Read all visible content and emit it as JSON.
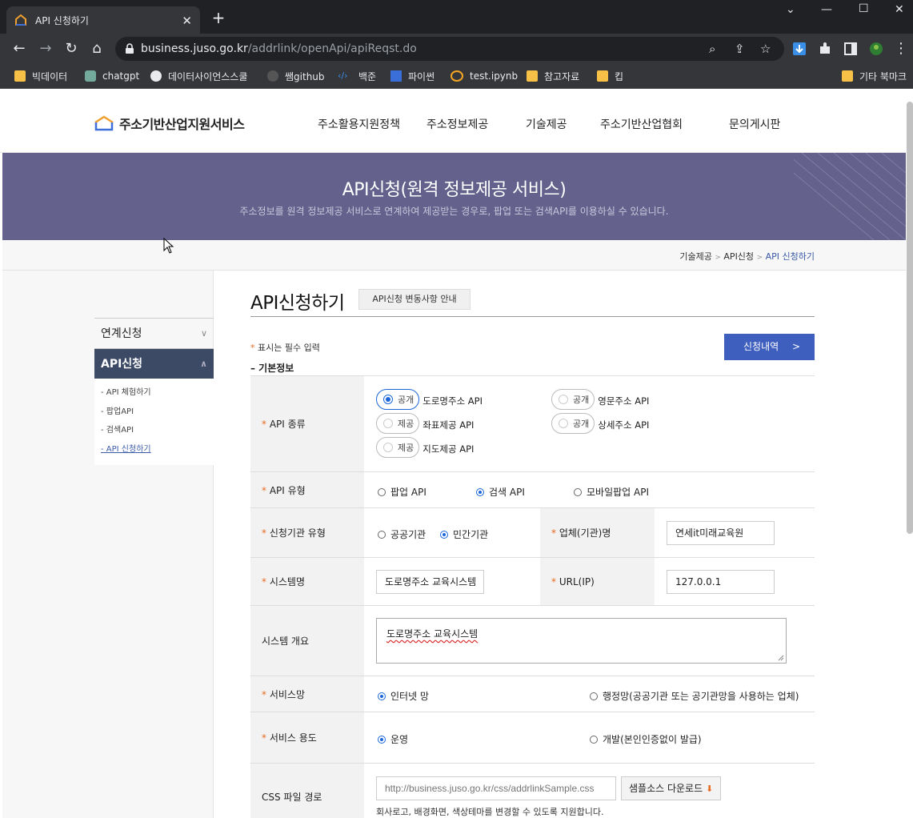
{
  "browser": {
    "tab_title": "API 신청하기",
    "close_symbol": "✕",
    "new_tab_symbol": "+",
    "url_domain": "business.juso.go.kr",
    "url_path": "/addrlink/openApi/apiReqst.do",
    "bookmarks": [
      "빅데이터",
      "chatgpt",
      "데이터사이언스스쿨",
      "쌤github",
      "백준",
      "파이썬",
      "test.ipynb",
      "참고자료",
      "킵"
    ],
    "bookmarks_other": "기타 북마크"
  },
  "site": {
    "logo_text": "주소기반산업지원서비스",
    "nav": [
      "주소활용지원정책",
      "주소정보제공",
      "기술제공",
      "주소기반산업협회",
      "문의게시판"
    ]
  },
  "banner": {
    "title": "API신청(원격 정보제공 서비스)",
    "subtitle": "주소정보를 원격 정보제공 서비스로 연계하여 제공받는 경우로, 팝업 또는 검색API를 이용하실 수 있습니다."
  },
  "breadcrumb": {
    "items": [
      "기술제공",
      "API신청"
    ],
    "current": "API 신청하기",
    "separator": ">"
  },
  "sidebar": {
    "menu1": "연계신청",
    "menu2": "API신청",
    "sub": [
      "API 체험하기",
      "팝업API",
      "검색API",
      "API 신청하기"
    ],
    "sub_prefix": "-"
  },
  "main": {
    "title": "API신청하기",
    "change_button": "API신청 변동사항 안내",
    "required_star": "*",
    "required_note": "표시는 필수 입력",
    "history_button": "신청내역",
    "history_arrow": ">",
    "section_title": "– 기본정보"
  },
  "form": {
    "api_kind": {
      "label": "API 종류",
      "options": [
        {
          "tag": "공개",
          "name": "도로명주소 API",
          "selected": true
        },
        {
          "tag": "공개",
          "name": "영문주소 API",
          "selected": false
        },
        {
          "tag": "제공",
          "name": "좌표제공 API",
          "selected": false
        },
        {
          "tag": "공개",
          "name": "상세주소 API",
          "selected": false
        },
        {
          "tag": "제공",
          "name": "지도제공 API",
          "selected": false
        }
      ]
    },
    "api_type": {
      "label": "API 유형",
      "options": [
        "팝업 API",
        "검색 API",
        "모바일팝업 API"
      ],
      "selected": "검색 API"
    },
    "org_type": {
      "label": "신청기관 유형",
      "options": [
        "공공기관",
        "민간기관"
      ],
      "selected": "민간기관"
    },
    "company": {
      "label": "업체(기관)명",
      "value": "연세it미래교육원"
    },
    "system_name": {
      "label": "시스템명",
      "value": "도로명주소 교육시스템"
    },
    "url": {
      "label": "URL(IP)",
      "value": "127.0.0.1"
    },
    "overview": {
      "label": "시스템 개요",
      "value": "도로명주소 교육시스템"
    },
    "network": {
      "label": "서비스망",
      "options": [
        "인터넷 망",
        "행정망(공공기관 또는 공기관망을 사용하는 업체)"
      ],
      "selected": "인터넷 망"
    },
    "purpose": {
      "label": "서비스 용도",
      "options": [
        "운영",
        "개발(본인인증없이 발급)"
      ],
      "selected": "운영"
    },
    "css_path": {
      "label": "CSS 파일 경로",
      "placeholder": "http://business.juso.go.kr/css/addrlinkSample.css",
      "download_button": "샘플소스 다운로드",
      "download_arrow": "⬇",
      "help": "회사로고, 배경화면, 색상테마를 변경할 수 있도록 지원합니다."
    }
  },
  "colors": {
    "banner": "#64628c",
    "sidebar_active": "#3d4a65",
    "history_button": "#3f5fbf",
    "required": "#e76c21",
    "radio_selected": "#1a66d9"
  }
}
